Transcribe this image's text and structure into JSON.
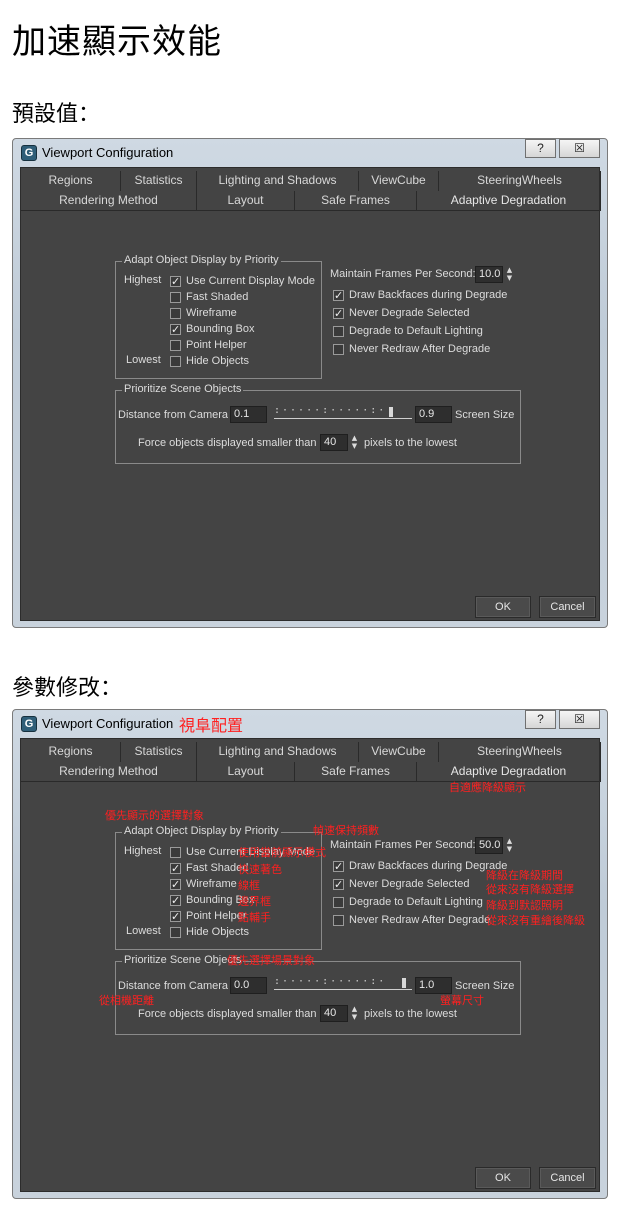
{
  "heading": "加速顯示效能",
  "section1_label": "預設值：",
  "section2_label": "參數修改：",
  "window": {
    "title": "Viewport Configuration",
    "help_label": "?",
    "close_label": "☒"
  },
  "tabs_row1": [
    "Regions",
    "Statistics",
    "Lighting and Shadows",
    "ViewCube",
    "SteeringWheels"
  ],
  "tabs_row2": [
    "Rendering Method",
    "Layout",
    "Safe Frames",
    "Adaptive Degradation"
  ],
  "adapt_group": {
    "title": "Adapt Object Display by Priority",
    "highest": "Highest",
    "lowest": "Lowest",
    "items": [
      "Use Current Display Mode",
      "Fast Shaded",
      "Wireframe",
      "Bounding Box",
      "Point Helper",
      "Hide Objects"
    ]
  },
  "maintain_label": "Maintain Frames Per Second:",
  "right_options": [
    "Draw Backfaces during Degrade",
    "Never Degrade Selected",
    "Degrade to Default Lighting",
    "Never Redraw After Degrade"
  ],
  "prioritize_group": {
    "title": "Prioritize Scene Objects",
    "distance_label": "Distance from Camera",
    "screen_size_label": "Screen Size",
    "force_label": "Force objects displayed smaller than",
    "pixels_label": "pixels to the lowest"
  },
  "ok_label": "OK",
  "cancel_label": "Cancel",
  "dialog1": {
    "checks": [
      true,
      false,
      false,
      true,
      false,
      false
    ],
    "right_checks": [
      true,
      true,
      false,
      false
    ],
    "fps": "10.0",
    "distance": "0.1",
    "screen": "0.9",
    "force_px": "40",
    "slider_level": 0.9
  },
  "dialog2": {
    "checks": [
      false,
      true,
      true,
      true,
      true,
      false
    ],
    "right_checks": [
      true,
      true,
      false,
      false
    ],
    "fps": "50.0",
    "distance": "0.0",
    "screen": "1.0",
    "force_px": "40",
    "slider_level": 1.0
  },
  "annotations": {
    "title_note": "視阜配置",
    "tab_note": "自適應降級顯示",
    "group_note": "優先顯示的選擇對象",
    "fps_note": "幀速保持頻數",
    "use_current_note": "使用當前顯示模式",
    "fast_shaded_note": "快速著色",
    "wireframe_note": "線框",
    "bbox_note": "邊界框",
    "point_note": "點輔手",
    "right_note_1": "降級在降級期間",
    "right_note_2": "從來沒有降級選擇",
    "right_note_3": "降級到默認照明",
    "right_note_4": "從來沒有重繪後降級",
    "prioritize_note": "優先選擇場景對象",
    "distance_note": "從相機距離",
    "screen_note": "螢幕尺寸"
  },
  "colors": {
    "annotation": "#ff2020",
    "panel": "#444444",
    "titlebar": "#c8d2dc"
  }
}
